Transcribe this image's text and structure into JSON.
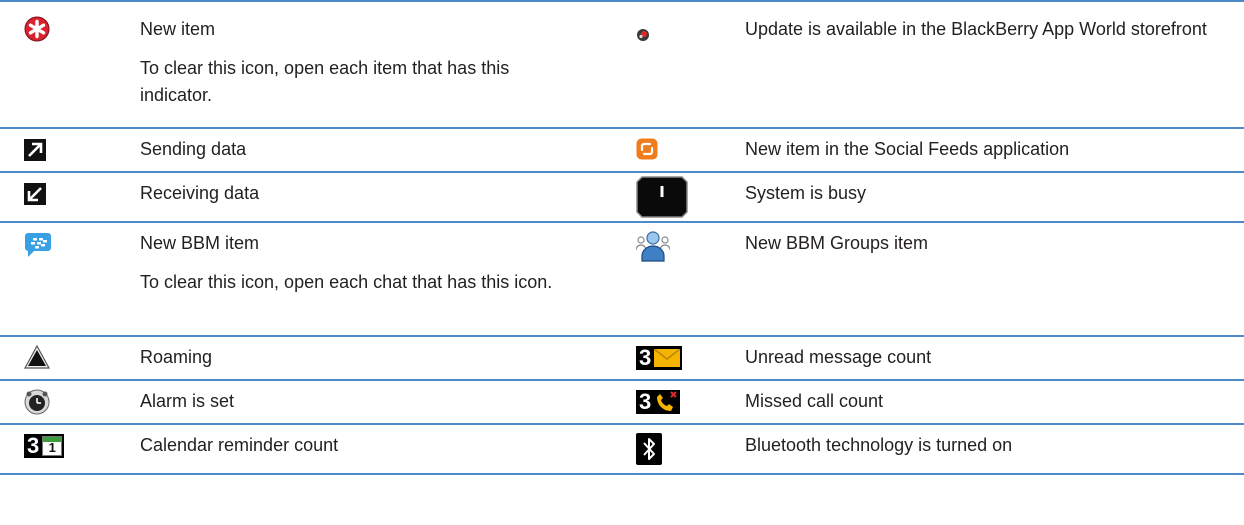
{
  "rows": [
    {
      "left": {
        "icon": "new-item-star-icon",
        "title": "New item",
        "note": "To clear this icon, open each item that has this indicator."
      },
      "right": {
        "icon": "app-world-update-icon",
        "title": "Update is available in the BlackBerry App World storefront"
      }
    },
    {
      "left": {
        "icon": "sending-data-arrow-icon",
        "title": "Sending data"
      },
      "right": {
        "icon": "social-feeds-icon",
        "title": "New item in the Social Feeds application"
      }
    },
    {
      "left": {
        "icon": "receiving-data-arrow-icon",
        "title": "Receiving data"
      },
      "right": {
        "icon": "system-busy-icon",
        "title": "System is busy"
      }
    },
    {
      "left": {
        "icon": "bbm-chat-icon",
        "title": "New BBM item",
        "note": "To clear this icon, open each chat that has this icon."
      },
      "right": {
        "icon": "bbm-groups-icon",
        "title": "New BBM Groups item"
      }
    },
    {
      "left": {
        "icon": "roaming-triangle-icon",
        "title": "Roaming"
      },
      "right": {
        "icon": "unread-message-count-icon",
        "title": "Unread message count",
        "count": "3"
      }
    },
    {
      "left": {
        "icon": "alarm-clock-icon",
        "title": "Alarm is set"
      },
      "right": {
        "icon": "missed-call-count-icon",
        "title": "Missed call count",
        "count": "3"
      }
    },
    {
      "left": {
        "icon": "calendar-reminder-count-icon",
        "title": "Calendar reminder count",
        "count": "3",
        "day": "1"
      },
      "right": {
        "icon": "bluetooth-icon",
        "title": "Bluetooth technology is turned on"
      }
    }
  ],
  "colors": {
    "rule": "#4b8ac7",
    "text": "#231f20"
  }
}
